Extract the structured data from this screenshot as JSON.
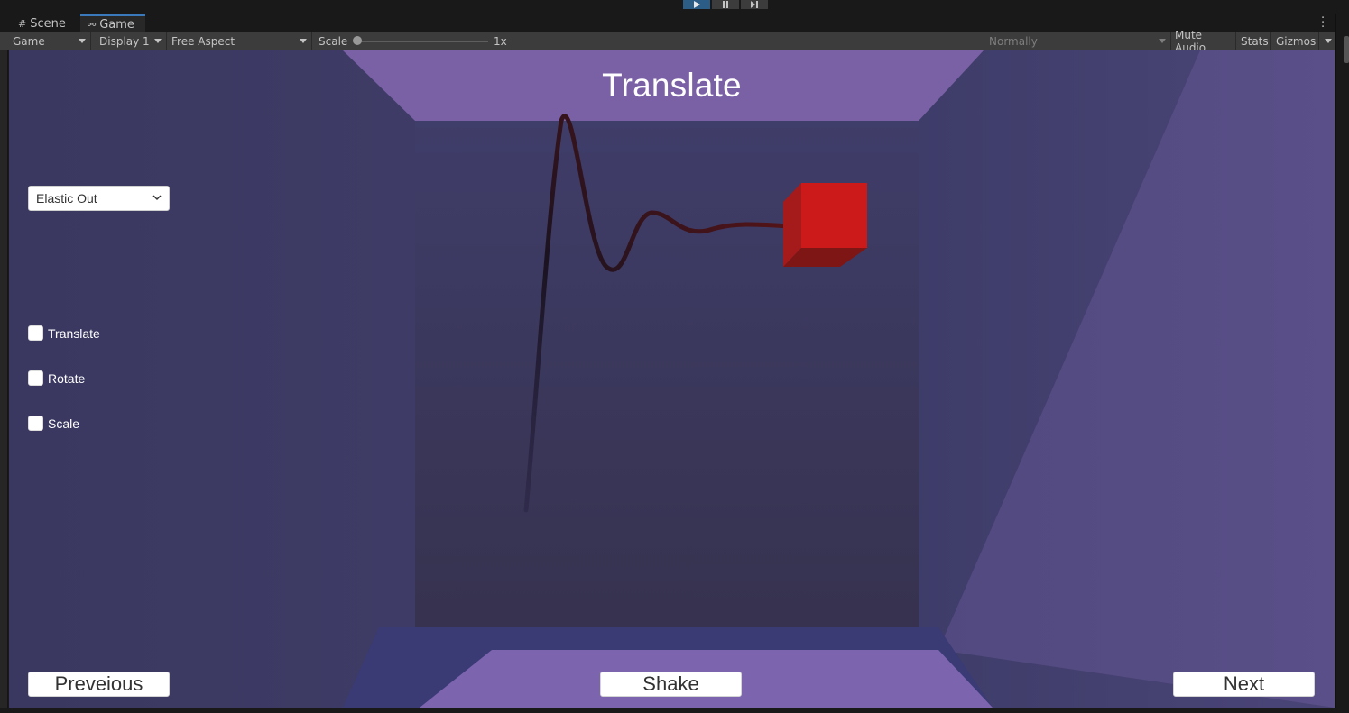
{
  "tabs": [
    {
      "label": "Scene",
      "icon": "grid-icon"
    },
    {
      "label": "Game",
      "icon": "gamepad-icon"
    }
  ],
  "toolbar": {
    "view_select": "Game",
    "display_select": "Display 1",
    "aspect_select": "Free Aspect",
    "scale_label": "Scale",
    "scale_value": "1x",
    "scale_fraction": 0.0,
    "play_focus_select": "Normally",
    "mute_audio": "Mute Audio",
    "stats": "Stats",
    "gizmos": "Gizmos"
  },
  "game": {
    "title": "Translate",
    "ease_dropdown": "Elastic Out",
    "toggles": [
      {
        "label": "Translate",
        "checked": false
      },
      {
        "label": "Rotate",
        "checked": false
      },
      {
        "label": "Scale",
        "checked": false
      }
    ],
    "buttons": {
      "previous": "Preveious",
      "shake": "Shake",
      "next": "Next"
    }
  },
  "colors": {
    "cube_front": "#cc1a1a",
    "wall_purple": "#7b62a6",
    "background": "#3c3a62",
    "play_active": "#2c5d87"
  }
}
